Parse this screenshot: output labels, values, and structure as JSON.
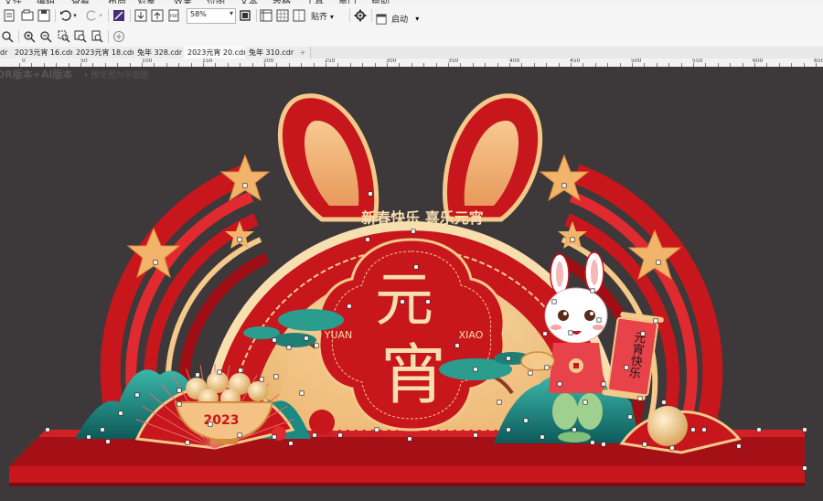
{
  "menu": [
    "文件",
    "编辑",
    "查看",
    "布局",
    "对象",
    "效果",
    "位图",
    "文本",
    "表格",
    "工具",
    "窗口",
    "帮助"
  ],
  "toolbar": {
    "zoom_value": "58%",
    "snap_label": "贴齐",
    "launch_label": "启动"
  },
  "tabs": [
    {
      "label": "dr",
      "active": false
    },
    {
      "label": "2023元宵 16.cdr",
      "active": false
    },
    {
      "label": "2023元宵 18.cdr",
      "active": false
    },
    {
      "label": "兔年 328.cdr",
      "active": false
    },
    {
      "label": "2023元宵 20.cdr",
      "active": true
    },
    {
      "label": "兔年 310.cdr",
      "active": false
    }
  ],
  "ruler": {
    "labels": [
      "0",
      "50",
      "100",
      "150",
      "200",
      "250",
      "300",
      "350",
      "400",
      "450",
      "500",
      "550",
      "600",
      "650",
      "700"
    ]
  },
  "canvas": {
    "caption_main": "DR版本+AI版本",
    "caption_sub": "预览图为平面图"
  },
  "artwork": {
    "banner_text": "新春快乐 喜乐元宵",
    "title_top": "元",
    "title_bottom": "宵",
    "left_pinyin": "YUAN",
    "right_pinyin": "XIAO",
    "year": "2023",
    "scroll_text": "元宵快乐",
    "colors": {
      "red": "#c8161d",
      "deep_red": "#9e0e14",
      "gold": "#f4c98a",
      "cream": "#f7dfb0",
      "teal": "#1c8a82",
      "background": "#3d3839"
    }
  }
}
